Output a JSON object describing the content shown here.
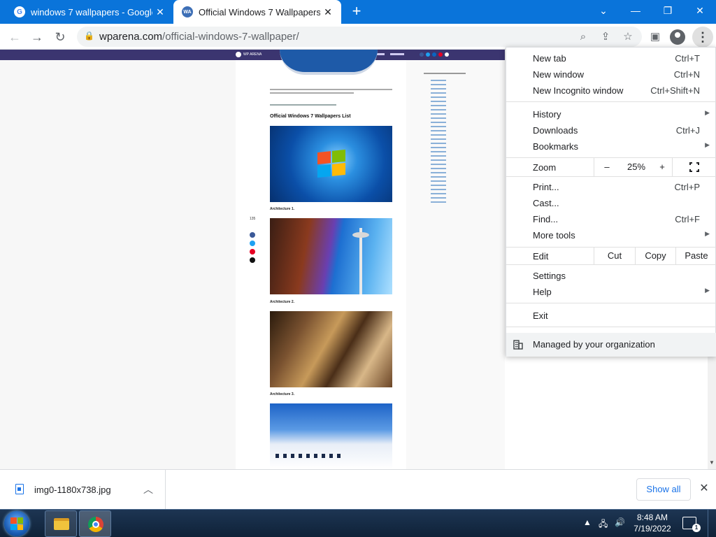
{
  "tabs": [
    {
      "title": "windows 7 wallpapers - Google S",
      "favicon": "google-icon",
      "active": false
    },
    {
      "title": "Official Windows 7 Wallpapers - ",
      "favicon": "wparena-icon",
      "active": true
    }
  ],
  "favicon_text": {
    "google": "G",
    "wparena": "WA"
  },
  "window_controls": {
    "dropdown": "⌄",
    "minimize": "—",
    "restore": "❐",
    "close": "✕"
  },
  "address": {
    "host": "wparena.com",
    "path": "/official-windows-7-wallpaper/"
  },
  "site": {
    "logo_text": "WP ARENA"
  },
  "article": {
    "heading": "Official Windows 7 Wallpapers List",
    "captions": [
      "Architecture 1.",
      "Architecture 2.",
      "Architecture 3."
    ],
    "share_count": "135"
  },
  "menu": {
    "items_top": [
      {
        "label": "New tab",
        "shortcut": "Ctrl+T"
      },
      {
        "label": "New window",
        "shortcut": "Ctrl+N"
      },
      {
        "label": "New Incognito window",
        "shortcut": "Ctrl+Shift+N"
      }
    ],
    "items_mid": [
      {
        "label": "History",
        "shortcut": "",
        "submenu": true
      },
      {
        "label": "Downloads",
        "shortcut": "Ctrl+J",
        "submenu": false
      },
      {
        "label": "Bookmarks",
        "shortcut": "",
        "submenu": true
      }
    ],
    "zoom": {
      "label": "Zoom",
      "minus": "–",
      "value": "25%",
      "plus": "+"
    },
    "items_tools": [
      {
        "label": "Print...",
        "shortcut": "Ctrl+P",
        "submenu": false
      },
      {
        "label": "Cast...",
        "shortcut": "",
        "submenu": false
      },
      {
        "label": "Find...",
        "shortcut": "Ctrl+F",
        "submenu": false
      },
      {
        "label": "More tools",
        "shortcut": "",
        "submenu": true
      }
    ],
    "edit": {
      "label": "Edit",
      "cut": "Cut",
      "copy": "Copy",
      "paste": "Paste"
    },
    "settings": "Settings",
    "help": "Help",
    "exit": "Exit",
    "managed": "Managed by your organization"
  },
  "download": {
    "filename": "img0-1180x738.jpg",
    "show_all": "Show all"
  },
  "taskbar": {
    "time": "8:48 AM",
    "date": "7/19/2022",
    "notification_count": "1"
  },
  "colors": {
    "tabstrip": "#0a74da",
    "site_header": "#3b3570",
    "link": "#1a73e8"
  }
}
